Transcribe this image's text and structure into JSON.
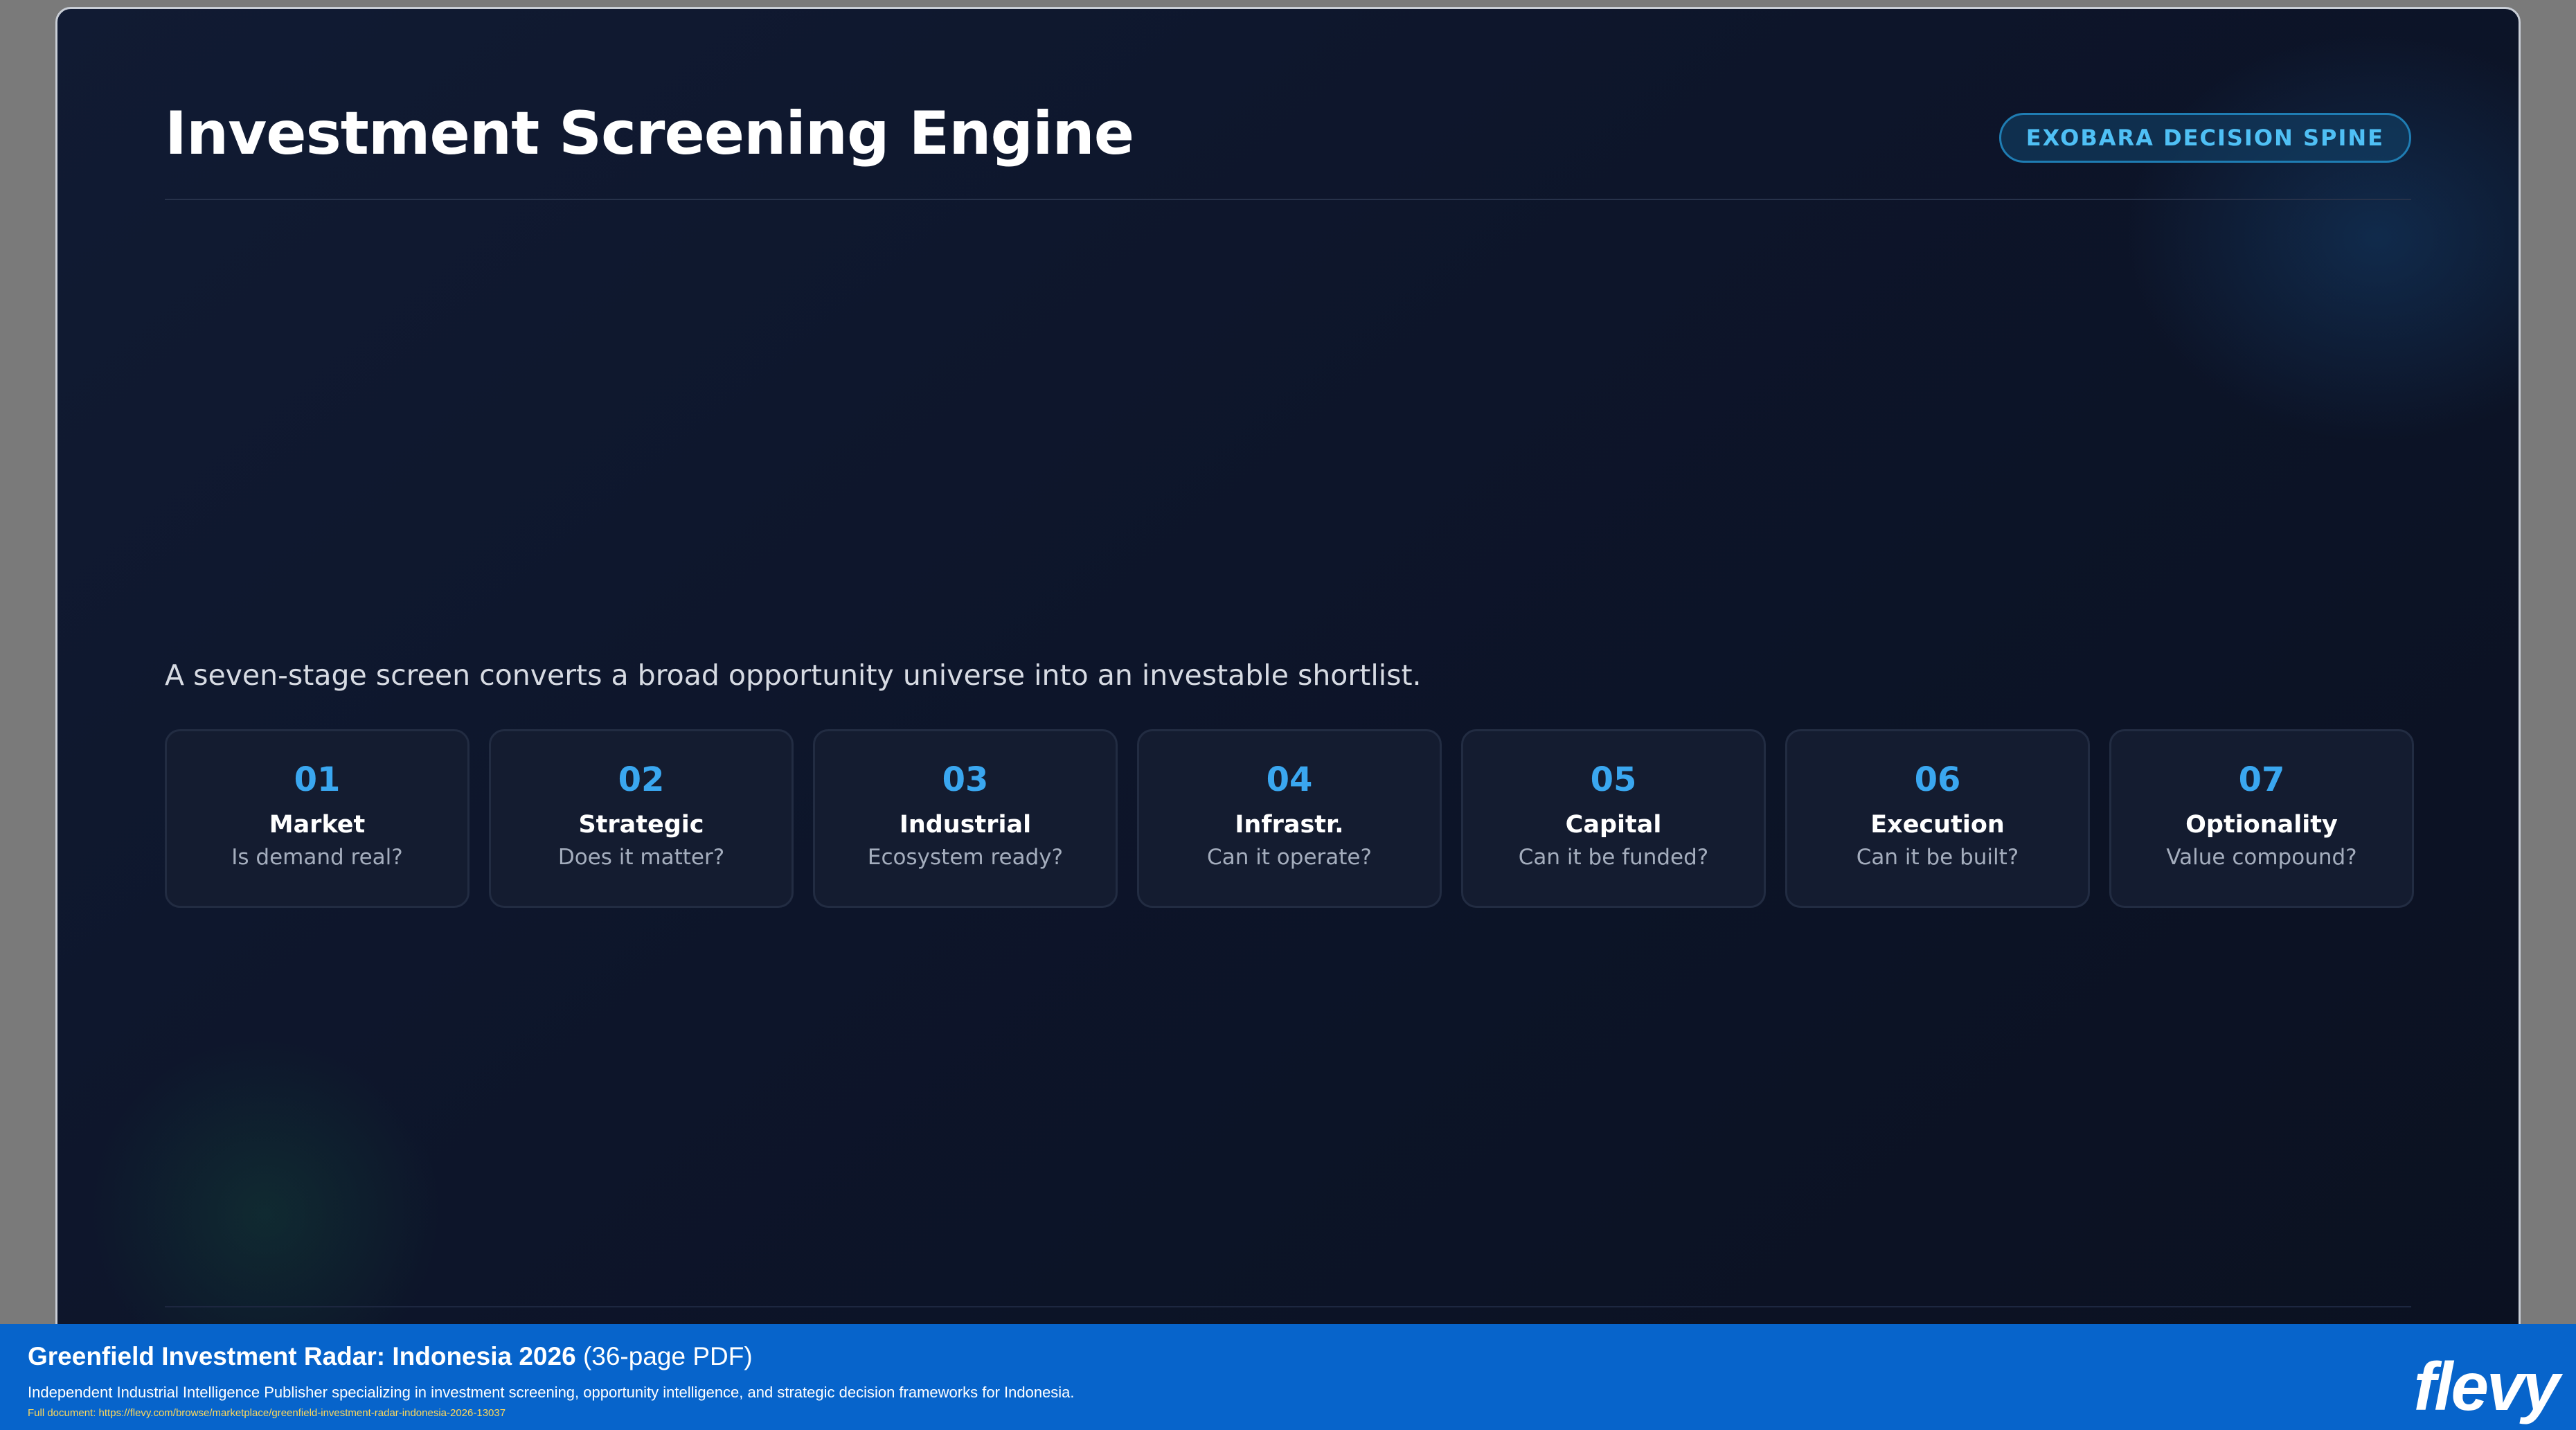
{
  "slide": {
    "title": "Investment Screening Engine",
    "badge": "EXOBARA DECISION SPINE",
    "subtitle": "A seven-stage screen converts a broad opportunity universe into an investable shortlist.",
    "stages": [
      {
        "num": "01",
        "name": "Market",
        "question": "Is demand real?"
      },
      {
        "num": "02",
        "name": "Strategic",
        "question": "Does it matter?"
      },
      {
        "num": "03",
        "name": "Industrial",
        "question": "Ecosystem ready?"
      },
      {
        "num": "04",
        "name": "Infrastr.",
        "question": "Can it operate?"
      },
      {
        "num": "05",
        "name": "Capital",
        "question": "Can it be funded?"
      },
      {
        "num": "06",
        "name": "Execution",
        "question": "Can it be built?"
      },
      {
        "num": "07",
        "name": "Optionality",
        "question": "Value compound?"
      }
    ]
  },
  "footer": {
    "title": "Greenfield Investment Radar: Indonesia 2026",
    "pages": "(36-page PDF)",
    "description": "Independent Industrial Intelligence Publisher specializing in investment screening, opportunity intelligence, and strategic decision frameworks for Indonesia.",
    "link": "Full document: https://flevy.com/browse/marketplace/greenfield-investment-radar-indonesia-2026-13037",
    "logo": "flevy"
  },
  "colors": {
    "accent": "#3aa7f0",
    "badge_text": "#4fc0f5",
    "footer_bg": "#0764cb",
    "slide_bg": "#0d152a"
  }
}
